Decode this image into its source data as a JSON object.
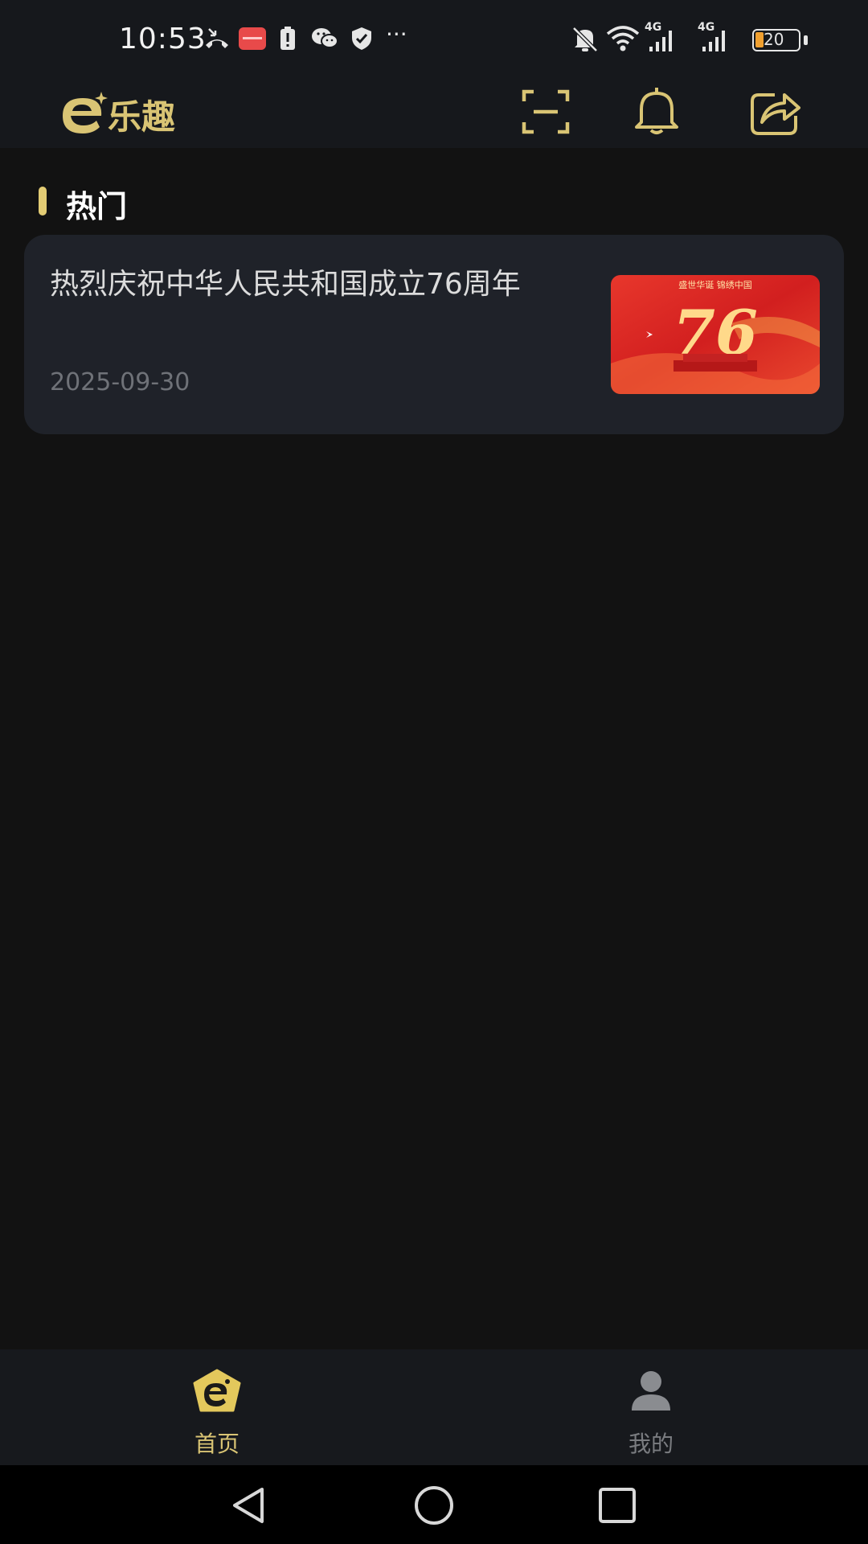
{
  "status_bar": {
    "time": "10:53",
    "network_left": "4G",
    "network_right": "4G",
    "battery": "20",
    "more": "···"
  },
  "header": {
    "logo_text": "乐趣",
    "icons": [
      "scan-icon",
      "bell-icon",
      "share-icon"
    ]
  },
  "section": {
    "title": "热门"
  },
  "articles": [
    {
      "title": "热烈庆祝中华人民共和国成立76周年",
      "date": "2025-09-30",
      "thumb_number": "76",
      "thumb_caption": "盛世华诞 锦绣中国"
    }
  ],
  "bottom_nav": {
    "items": [
      {
        "label": "首页",
        "active": true
      },
      {
        "label": "我的",
        "active": false
      }
    ]
  },
  "colors": {
    "accent": "#d9c474",
    "background": "#121212",
    "card": "#1f2229",
    "inactive": "#7a7c80"
  }
}
